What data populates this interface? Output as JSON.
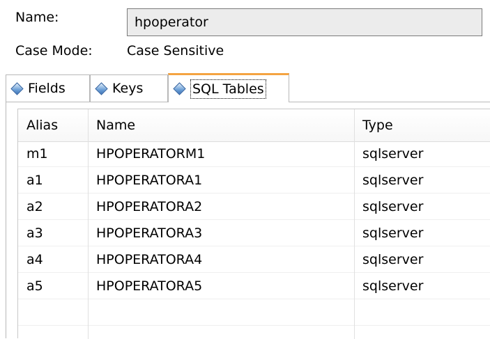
{
  "form": {
    "name_label": "Name:",
    "name_value": "hpoperator",
    "case_mode_label": "Case Mode:",
    "case_mode_value": "Case Sensitive"
  },
  "tabs": [
    {
      "label": "Fields",
      "icon": "diamond-icon",
      "selected": false
    },
    {
      "label": "Keys",
      "icon": "diamond-icon",
      "selected": false
    },
    {
      "label": "SQL Tables",
      "icon": "diamond-icon",
      "selected": true
    }
  ],
  "table": {
    "columns": [
      "Alias",
      "Name",
      "Type"
    ],
    "rows": [
      {
        "alias": "m1",
        "name": "HPOPERATORM1",
        "type": "sqlserver"
      },
      {
        "alias": "a1",
        "name": "HPOPERATORA1",
        "type": "sqlserver"
      },
      {
        "alias": "a2",
        "name": "HPOPERATORA2",
        "type": "sqlserver"
      },
      {
        "alias": "a3",
        "name": "HPOPERATORA3",
        "type": "sqlserver"
      },
      {
        "alias": "a4",
        "name": "HPOPERATORA4",
        "type": "sqlserver"
      },
      {
        "alias": "a5",
        "name": "HPOPERATORA5",
        "type": "sqlserver"
      }
    ]
  },
  "colors": {
    "active_tab_accent": "#f4a341",
    "field_background": "#ececec",
    "border": "#b8b8b8"
  }
}
